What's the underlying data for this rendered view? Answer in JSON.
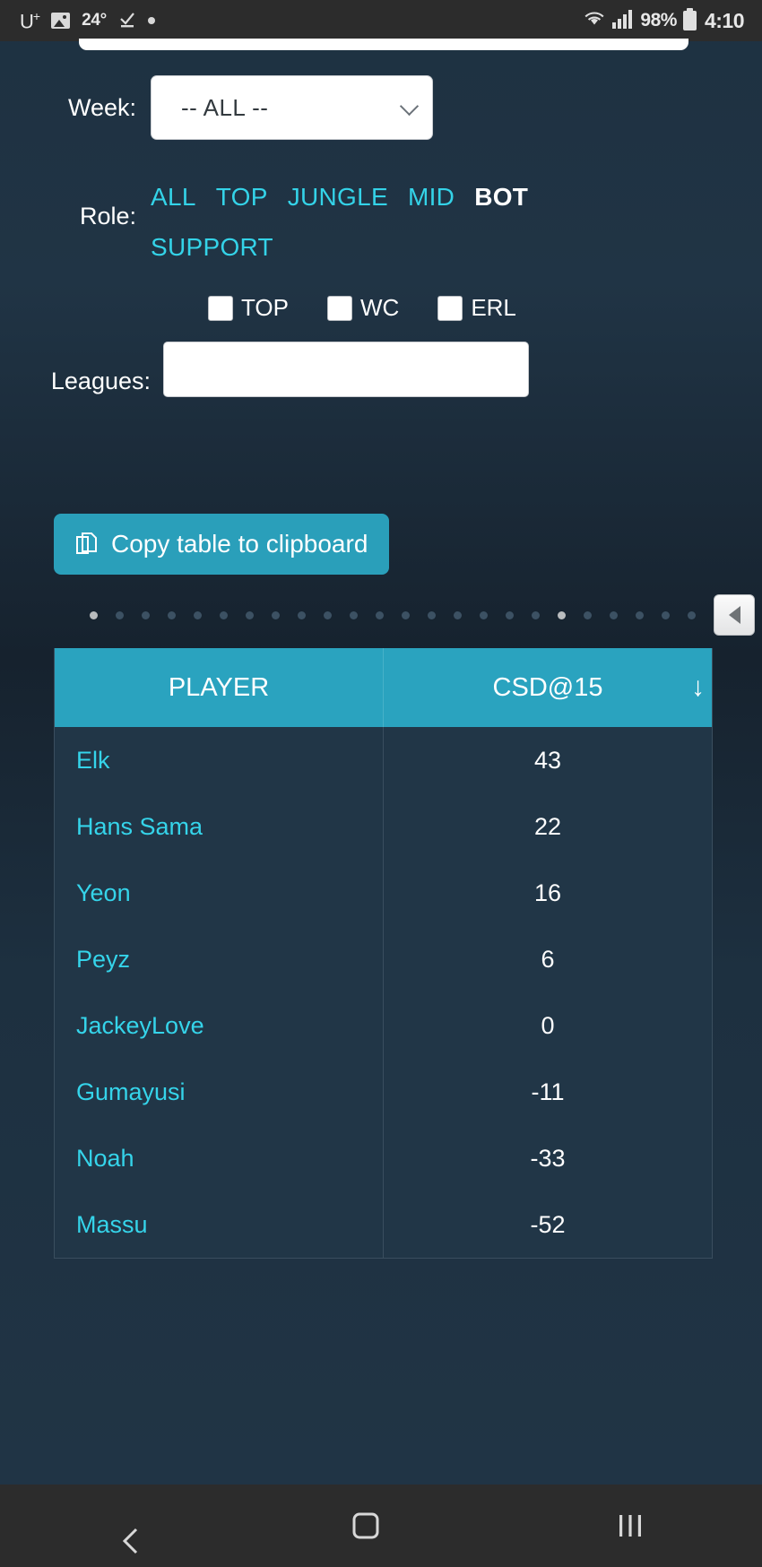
{
  "status_bar": {
    "carrier": "U",
    "carrier_sup": "+",
    "temperature": "24°",
    "battery_percent": "98%",
    "clock": "4:10",
    "icons": [
      "image-icon",
      "check-icon",
      "dot-icon",
      "wifi-icon",
      "signal-icon",
      "battery-icon"
    ]
  },
  "filters": {
    "week_label": "Week:",
    "week_value": "-- ALL --",
    "week_options": [
      "-- ALL --"
    ],
    "role_label": "Role:",
    "roles": [
      {
        "label": "ALL",
        "active": false
      },
      {
        "label": "TOP",
        "active": false
      },
      {
        "label": "JUNGLE",
        "active": false
      },
      {
        "label": "MID",
        "active": false
      },
      {
        "label": "BOT",
        "active": true
      },
      {
        "label": "SUPPORT",
        "active": false
      }
    ],
    "leagues_label": "Leagues:",
    "leagues_value": "",
    "league_checkboxes": [
      {
        "label": "TOP",
        "checked": false
      },
      {
        "label": "WC",
        "checked": false
      },
      {
        "label": "ERL",
        "checked": false
      }
    ]
  },
  "toolbar": {
    "copy_label": "Copy table to clipboard"
  },
  "pager": {
    "total_dots": 24,
    "active_dots": [
      0,
      18
    ],
    "prev_label": "◀",
    "next_label": "▶"
  },
  "table": {
    "columns": [
      "PLAYER",
      "CSD@15"
    ],
    "sort_column": "CSD@15",
    "sort_indicator": "↓",
    "rows": [
      {
        "player": "Elk",
        "csd15": "43"
      },
      {
        "player": "Hans Sama",
        "csd15": "22"
      },
      {
        "player": "Yeon",
        "csd15": "16"
      },
      {
        "player": "Peyz",
        "csd15": "6"
      },
      {
        "player": "JackeyLove",
        "csd15": "0"
      },
      {
        "player": "Gumayusi",
        "csd15": "-11"
      },
      {
        "player": "Noah",
        "csd15": "-33"
      },
      {
        "player": "Massu",
        "csd15": "-52"
      }
    ]
  },
  "nav_bar": {
    "items": [
      "back-icon",
      "home-icon",
      "recents-icon"
    ]
  },
  "colors": {
    "accent_teal": "#2aa3bf",
    "link_cyan": "#35d4ea",
    "page_bg": "#1f3242",
    "status_bg": "#2c2c2c"
  }
}
